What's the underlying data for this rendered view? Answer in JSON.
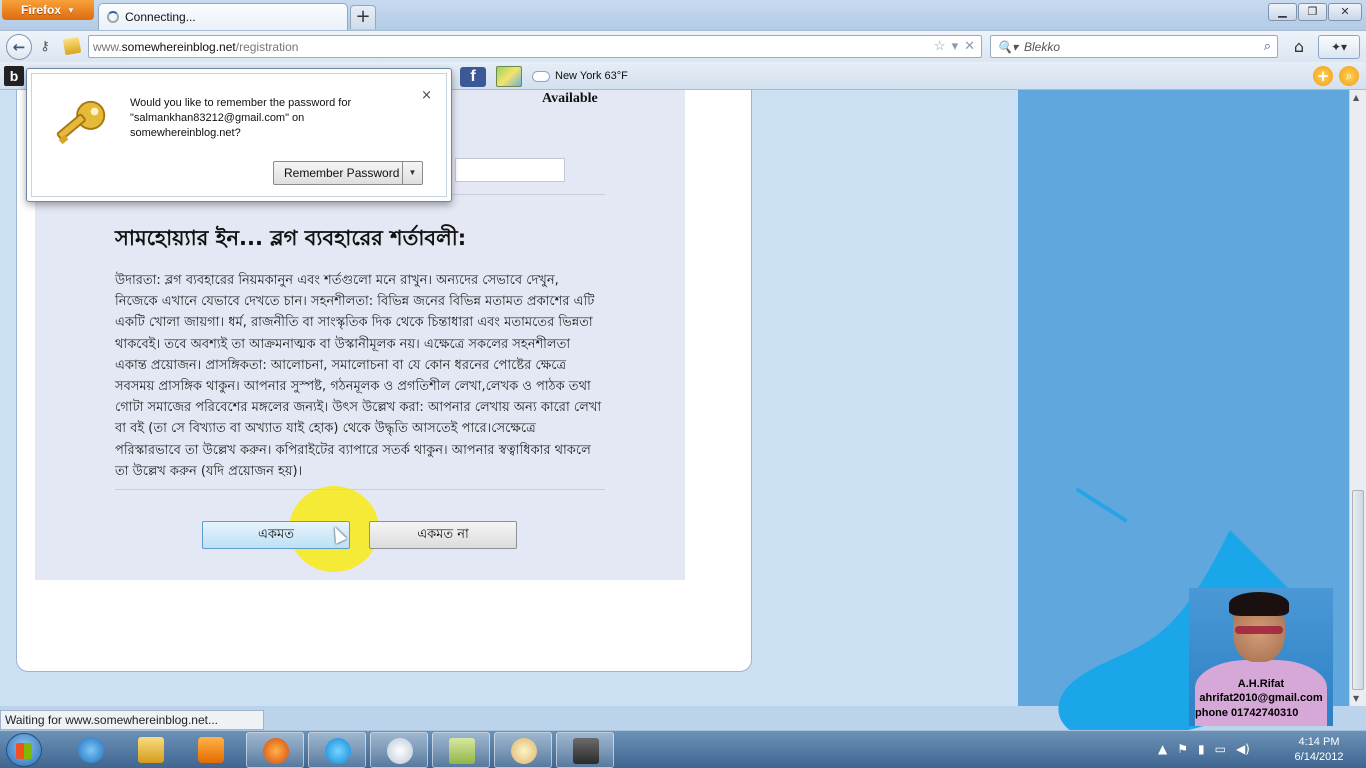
{
  "browser": {
    "app_button": "Firefox",
    "tab_title": "Connecting...",
    "url_prefix": "www.",
    "url_host": "somewhereinblog.net",
    "url_path": "/registration",
    "search_engine": "Blekko",
    "weather": "New York 63°F",
    "status_text": "Waiting for www.somewhereinblog.net..."
  },
  "password_prompt": {
    "message": "Would you like to remember the password for \"salmankhan83212@gmail.com\" on somewhereinblog.net?",
    "remember_label": "Remember Password",
    "close_glyph": "×"
  },
  "registration": {
    "available_label": "Available",
    "terms_title": "সামহোয়্যার ইন... ব্লগ ব্যবহারের শর্তাবলী:",
    "terms_body": "উদারতা: ব্লগ ব্যবহারের নিয়মকানুন এবং শর্তগুলো মনে রাখুন। অন্যদের সেভাবে দেখুন, নিজেকে এখানে যেভাবে দেখতে চান। সহনশীলতা: বিভিন্ন জনের বিভিন্ন মতামত প্রকাশের এটি একটি খোলা জায়গা। ধর্ম, রাজনীতি বা সাংস্কৃতিক দিক থেকে চিন্তাধারা এবং মতামতের ভিন্নতা থাকবেই। তবে অবশ্যই তা আক্রমনাত্মক বা উস্কানীমূলক নয়। এক্ষেত্রে সকলের সহনশীলতা একান্ত প্রয়োজন। প্রাসঙ্গিকতা: আলোচনা, সমালোচনা বা যে কোন ধরনের পোষ্টের ক্ষেত্রে সবসময় প্রাসঙ্গিক থাকুন। আপনার সুস্পষ্ট, গঠনমূলক ও প্রগতিশীল লেখা,লেখক ও পাঠক তথা গোটা সমাজের পরিবেশের মঙ্গলের জন্যই। উৎস উল্লেখ করা: আপনার লেখায় অন্য কারো লেখা বা বই (তা সে বিখ্যাত বা অখ্যাত যাই হোক) থেকে উদ্ধৃতি আসতেই পারে।সেক্ষেত্রে পরিস্কারভাবে তা উল্লেখ করুন। কপিরাইটের ব্যাপারে সতর্ক থাকুন। আপনার স্বত্বাধিকার থাকলে তা উল্লেখ করুন (যদি প্রয়োজন হয়)।",
    "agree_label": "একমত",
    "disagree_label": "একমত না"
  },
  "webcam": {
    "name": "A.H.Rifat",
    "email": "ahrifat2010@gmail.com",
    "phone": "phone 01742740310"
  },
  "taskbar": {
    "time": "4:14 PM",
    "date": "6/14/2012"
  },
  "colors": {
    "firefox_orange": "#e9791d",
    "page_background": "#5fa7dc",
    "agree_button": "#bde0f6",
    "cursor_highlight": "#faeb00",
    "facebook_blue": "#3b5998"
  },
  "icons": [
    "back-arrow-icon",
    "key-icon",
    "star-icon",
    "home-icon",
    "search-icon",
    "facebook-icon",
    "cloud-icon"
  ]
}
